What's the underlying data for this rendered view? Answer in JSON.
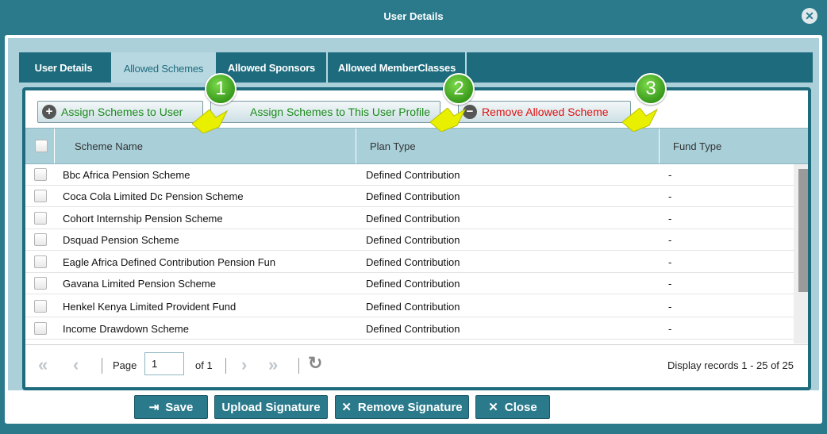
{
  "window": {
    "title": "User Details",
    "close_icon": "close-circle-icon"
  },
  "tabs": [
    {
      "label": "User Details",
      "active": false
    },
    {
      "label": "Allowed Schemes",
      "active": true
    },
    {
      "label": "Allowed Sponsors",
      "active": false
    },
    {
      "label": "Allowed MemberClasses",
      "active": false
    }
  ],
  "toolbar": {
    "assign_user_label": "Assign Schemes to User",
    "assign_profile_label": "Assign Schemes to This User Profile",
    "remove_label": "Remove Allowed Scheme"
  },
  "callouts": [
    "1",
    "2",
    "3"
  ],
  "grid": {
    "columns": [
      "Scheme Name",
      "Plan Type",
      "Fund Type"
    ],
    "rows": [
      {
        "scheme": "Bbc Africa Pension Scheme",
        "plan": "Defined Contribution",
        "fund": "-"
      },
      {
        "scheme": "Coca Cola Limited Dc Pension Scheme",
        "plan": "Defined Contribution",
        "fund": "-"
      },
      {
        "scheme": "Cohort Internship Pension Scheme",
        "plan": "Defined Contribution",
        "fund": "-"
      },
      {
        "scheme": "Dsquad Pension Scheme",
        "plan": "Defined Contribution",
        "fund": "-"
      },
      {
        "scheme": "Eagle Africa Defined Contribution Pension Fun",
        "plan": "Defined Contribution",
        "fund": "-"
      },
      {
        "scheme": "Gavana Limited Pension Scheme",
        "plan": "Defined Contribution",
        "fund": "-"
      },
      {
        "scheme": "Henkel Kenya Limited Provident Fund",
        "plan": "Defined Contribution",
        "fund": "-"
      },
      {
        "scheme": "Income Drawdown Scheme",
        "plan": "Defined Contribution",
        "fund": "-"
      }
    ]
  },
  "pager": {
    "page_label": "Page",
    "page_value": "1",
    "of_label": "of 1",
    "display_text": "Display records 1 - 25 of 25"
  },
  "footer": {
    "save_label": "Save",
    "upload_label": "Upload Signature",
    "remove_sig_label": "Remove Signature",
    "close_label": "Close"
  },
  "colors": {
    "brand": "#2a7a8c",
    "tab_bar": "#1d6b7d",
    "header_bg": "#a9cfd9",
    "callout_green": "#3a9a1c",
    "add_text": "#1a8a1a",
    "remove_text": "#e01010"
  }
}
